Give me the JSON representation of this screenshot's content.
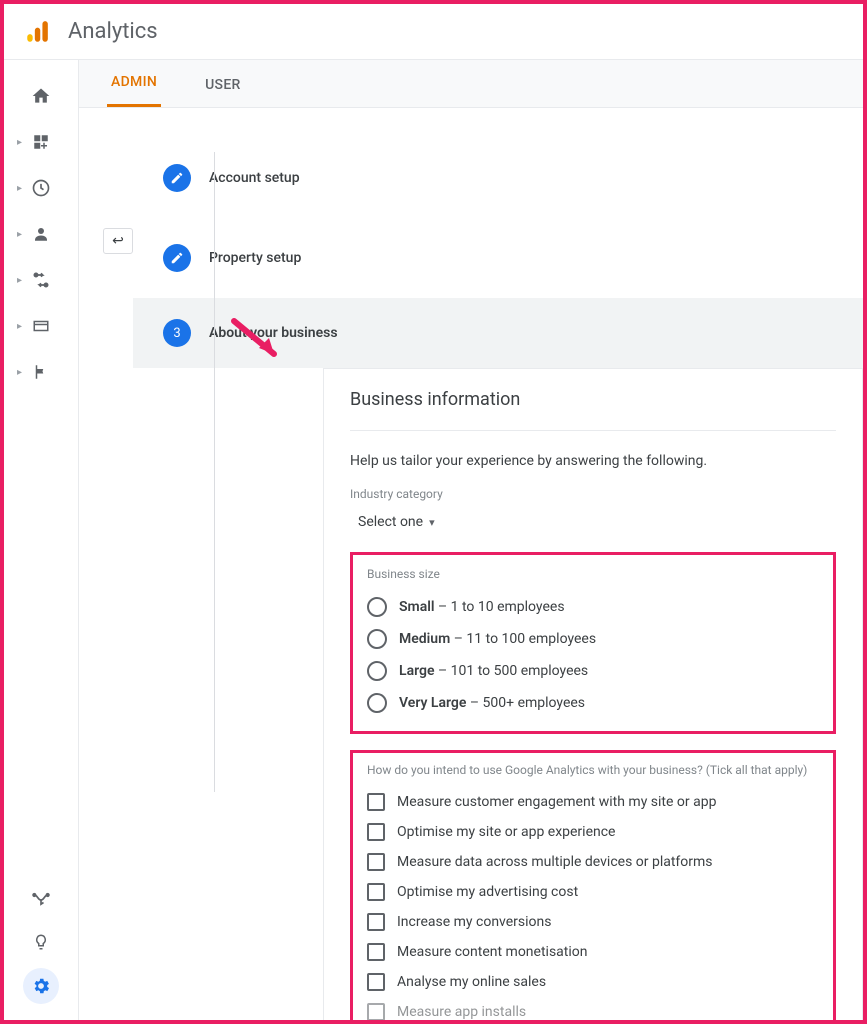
{
  "app": {
    "title": "Analytics"
  },
  "tabs": {
    "admin": "ADMIN",
    "user": "USER"
  },
  "steps": {
    "s1": "Account setup",
    "s2": "Property setup",
    "s3_num": "3",
    "s3": "About your business"
  },
  "panel": {
    "title": "Business information",
    "help": "Help us tailor your experience by answering the following.",
    "industry_label": "Industry category",
    "select_one": "Select one",
    "size_label": "Business size",
    "sizes": [
      {
        "b": "Small",
        "t": " – 1 to 10 employees"
      },
      {
        "b": "Medium",
        "t": " – 11 to 100 employees"
      },
      {
        "b": "Large",
        "t": " – 101 to 500 employees"
      },
      {
        "b": "Very Large",
        "t": " – 500+ employees"
      }
    ],
    "intent_label": "How do you intend to use Google Analytics with your business? (Tick all that apply)",
    "intents": [
      "Measure customer engagement with my site or app",
      "Optimise my site or app experience",
      "Measure data across multiple devices or platforms",
      "Optimise my advertising cost",
      "Increase my conversions",
      "Measure content monetisation",
      "Analyse my online sales",
      "Measure app installs"
    ]
  }
}
